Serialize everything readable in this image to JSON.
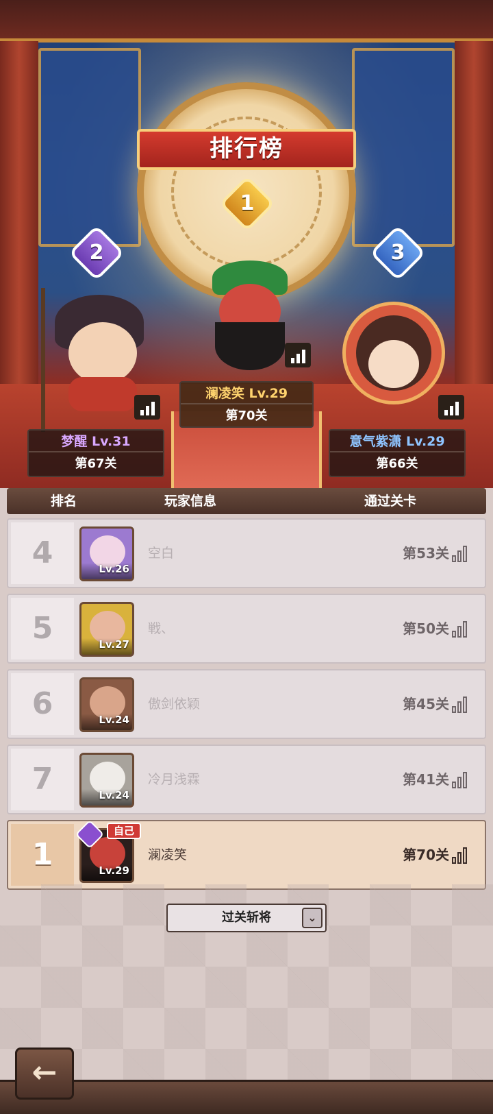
{
  "title": "排行榜",
  "podium": [
    {
      "rank": "1",
      "name": "澜凌笑",
      "level": "Lv.29",
      "stage": "第70关"
    },
    {
      "rank": "2",
      "name": "梦醒",
      "level": "Lv.31",
      "stage": "第67关"
    },
    {
      "rank": "3",
      "name": "意气紫潇",
      "level": "Lv.29",
      "stage": "第66关"
    }
  ],
  "table": {
    "headers": {
      "rank": "排名",
      "info": "玩家信息",
      "stage": "通过关卡"
    },
    "rows": [
      {
        "rank": "4",
        "name": "空白",
        "level": "Lv.26",
        "stage": "第53关",
        "avatar_color": "#b9a4e8"
      },
      {
        "rank": "5",
        "name": "戦、",
        "level": "Lv.27",
        "stage": "第50关",
        "avatar_color": "#e8b79e"
      },
      {
        "rank": "6",
        "name": "傲剑依颖",
        "level": "Lv.24",
        "stage": "第45关",
        "avatar_color": "#d9a58a"
      },
      {
        "rank": "7",
        "name": "冷月浅霖",
        "level": "Lv.24",
        "stage": "第41关",
        "avatar_color": "#d8d4d0"
      }
    ],
    "self_row": {
      "rank": "1",
      "name": "澜凌笑",
      "level": "Lv.29",
      "stage": "第70关",
      "tag": "自己",
      "avatar_color": "#c8423a"
    }
  },
  "dropdown": {
    "selected": "过关斩将",
    "caret": "⌄"
  },
  "back_button": {
    "icon": "←"
  },
  "colors": {
    "accent_red": "#d43b2e",
    "gold": "#f6cf7c",
    "self_row_bg": "#efd9c4"
  }
}
